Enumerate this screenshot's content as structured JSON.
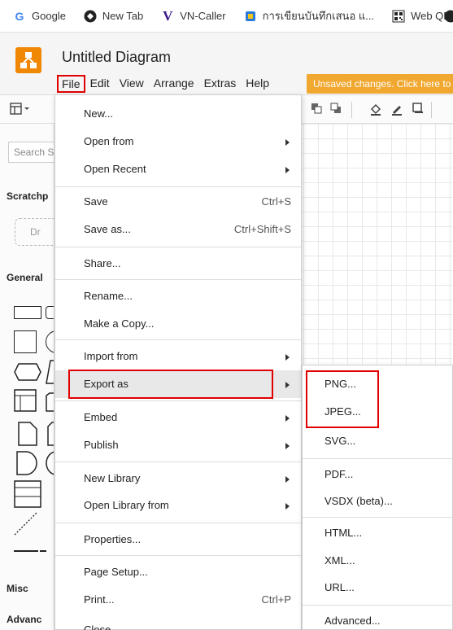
{
  "bookmarks": [
    {
      "icon": "google-icon",
      "glyph": "G",
      "color": "#4285f4",
      "label": "Google"
    },
    {
      "icon": "globe-icon",
      "glyph": "◑",
      "color": "#222222",
      "label": "New Tab"
    },
    {
      "icon": "vn-caller-icon",
      "glyph": "V",
      "color": "#3a1a8a",
      "label": "VN-Caller"
    },
    {
      "icon": "notebook-icon",
      "glyph": "▣",
      "color": "#2a7bd8",
      "label": "การเขียนบันทึกเสนอ แ..."
    },
    {
      "icon": "qr-code-icon",
      "glyph": "▦",
      "color": "#222222",
      "label": "Web QR"
    }
  ],
  "app": {
    "title": "Untitled Diagram",
    "brand_color": "#f08705",
    "menu": [
      "File",
      "Edit",
      "View",
      "Arrange",
      "Extras",
      "Help"
    ],
    "unsaved_notice": "Unsaved changes. Click here to"
  },
  "sidebar": {
    "search_placeholder": "Search S",
    "scratchpad": "Scratchp",
    "drop_hint": "Dr",
    "general": "General",
    "misc": "Misc",
    "advanced": "Advanc"
  },
  "file_menu": {
    "items": [
      {
        "label": "New...",
        "shortcut": "",
        "submenu": false
      },
      {
        "label": "Open from",
        "shortcut": "",
        "submenu": true
      },
      {
        "label": "Open Recent",
        "shortcut": "",
        "submenu": true
      },
      {
        "label": "Save",
        "shortcut": "Ctrl+S",
        "submenu": false
      },
      {
        "label": "Save as...",
        "shortcut": "Ctrl+Shift+S",
        "submenu": false
      },
      {
        "label": "Share...",
        "shortcut": "",
        "submenu": false
      },
      {
        "label": "Rename...",
        "shortcut": "",
        "submenu": false
      },
      {
        "label": "Make a Copy...",
        "shortcut": "",
        "submenu": false
      },
      {
        "label": "Import from",
        "shortcut": "",
        "submenu": true
      },
      {
        "label": "Export as",
        "shortcut": "",
        "submenu": true
      },
      {
        "label": "Embed",
        "shortcut": "",
        "submenu": true
      },
      {
        "label": "Publish",
        "shortcut": "",
        "submenu": true
      },
      {
        "label": "New Library",
        "shortcut": "",
        "submenu": true
      },
      {
        "label": "Open Library from",
        "shortcut": "",
        "submenu": true
      },
      {
        "label": "Properties...",
        "shortcut": "",
        "submenu": false
      },
      {
        "label": "Page Setup...",
        "shortcut": "",
        "submenu": false
      },
      {
        "label": "Print...",
        "shortcut": "Ctrl+P",
        "submenu": false
      },
      {
        "label": "Close",
        "shortcut": "",
        "submenu": false
      }
    ]
  },
  "export_menu": {
    "items": [
      "PNG...",
      "JPEG...",
      "SVG...",
      "PDF...",
      "VSDX (beta)...",
      "HTML...",
      "XML...",
      "URL...",
      "Advanced..."
    ]
  },
  "highlight_color": "#e00000"
}
